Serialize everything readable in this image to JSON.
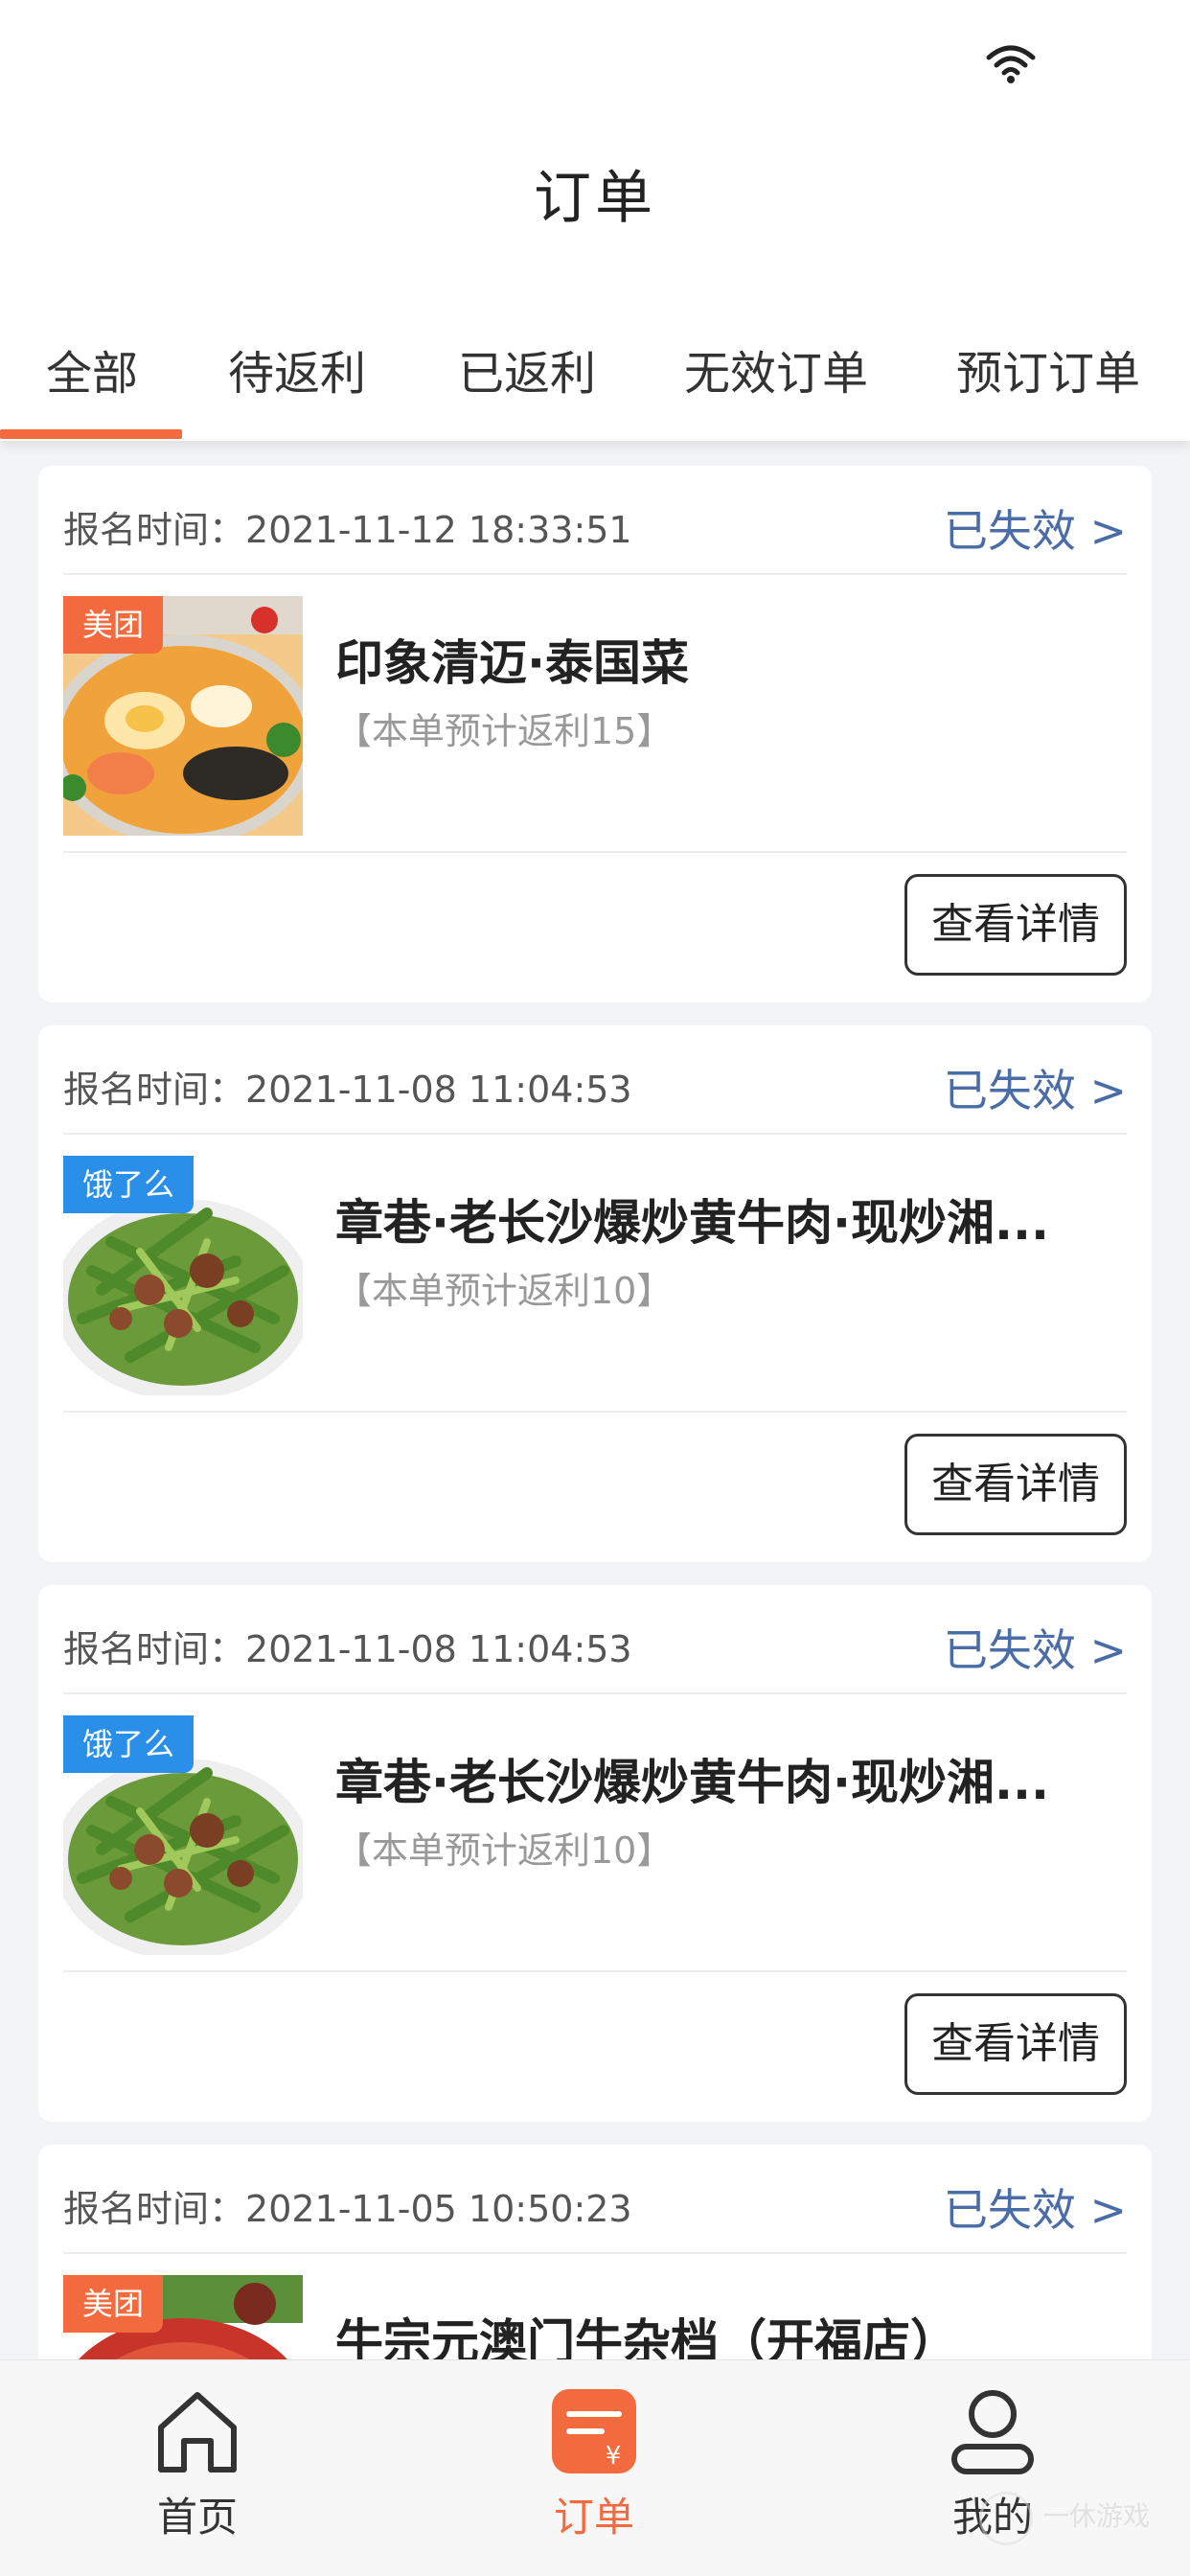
{
  "header": {
    "title": "订单"
  },
  "tabs": [
    {
      "label": "全部",
      "active": true
    },
    {
      "label": "待返利",
      "active": false
    },
    {
      "label": "已返利",
      "active": false
    },
    {
      "label": "无效订单",
      "active": false
    },
    {
      "label": "预订订单",
      "active": false
    }
  ],
  "orders": [
    {
      "signup_label": "报名时间：",
      "signup_time": "2021-11-12 18:33:51",
      "status": "已失效 >",
      "platform": "美团",
      "shop_name": "印象清迈·泰国菜",
      "rebate_note": "【本单预计返利15】",
      "detail_button": "查看详情"
    },
    {
      "signup_label": "报名时间：",
      "signup_time": "2021-11-08 11:04:53",
      "status": "已失效 >",
      "platform": "饿了么",
      "shop_name": "章巷·老长沙爆炒黄牛肉·现炒湘...",
      "rebate_note": "【本单预计返利10】",
      "detail_button": "查看详情"
    },
    {
      "signup_label": "报名时间：",
      "signup_time": "2021-11-08 11:04:53",
      "status": "已失效 >",
      "platform": "饿了么",
      "shop_name": "章巷·老长沙爆炒黄牛肉·现炒湘...",
      "rebate_note": "【本单预计返利10】",
      "detail_button": "查看详情"
    },
    {
      "signup_label": "报名时间：",
      "signup_time": "2021-11-05 10:50:23",
      "status": "已失效 >",
      "platform": "美团",
      "shop_name": "牛宗元澳门牛杂档（开福店）",
      "rebate_note": "",
      "detail_button": ""
    }
  ],
  "bottom_nav": [
    {
      "label": "首页",
      "icon": "home-icon",
      "active": false
    },
    {
      "label": "订单",
      "icon": "order-icon",
      "active": true
    },
    {
      "label": "我的",
      "icon": "profile-icon",
      "active": false
    }
  ],
  "watermark": {
    "text": "一休游戏"
  },
  "colors": {
    "accent": "#f26a3d",
    "meituan": "#f26a3d",
    "eleme": "#2a8fe8",
    "status_link": "#4a6da7"
  }
}
